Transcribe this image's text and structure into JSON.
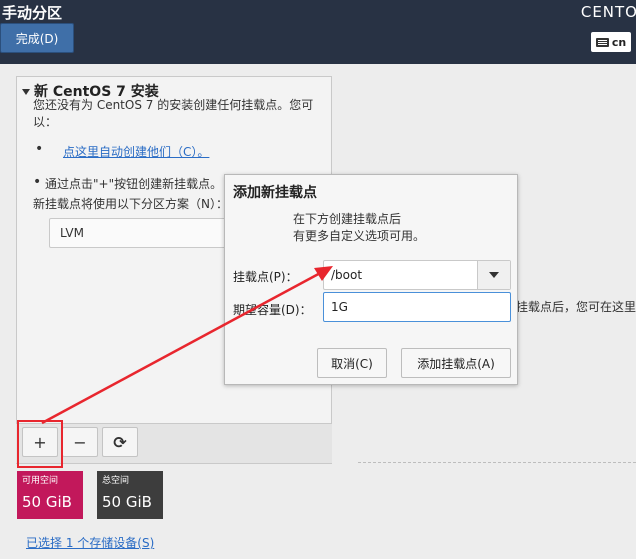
{
  "header": {
    "title": "手动分区",
    "product": "CENTO",
    "done_label": "完成(D)",
    "keyboard_layout": "cn"
  },
  "left_panel": {
    "section_title": "新 CentOS 7 安装",
    "description": "您还没有为 CentOS 7 的安装创建任何挂载点。您可以：",
    "auto_create_link": "点这里自动创建他们（C）。",
    "manual_hint": "通过点击\"+\"按钮创建新挂载点。",
    "scheme_label": "新挂载点将使用以下分区方案（N）：",
    "scheme_value": "LVM",
    "toolbar": {
      "add": "+",
      "remove": "−",
      "refresh": "⟳"
    }
  },
  "storage": {
    "available_label": "可用空间",
    "available_value": "50 GiB",
    "available_color": "#c2185b",
    "total_label": "总空间",
    "total_value": "50 GiB",
    "total_color": "#3d3d3d",
    "selected_link": "已选择 1 个存储设备(S)"
  },
  "right_panel": {
    "partial_text": "挂载点后，您可在这里"
  },
  "dialog": {
    "title": "添加新挂载点",
    "description_line1": "在下方创建挂载点后",
    "description_line2": "有更多自定义选项可用。",
    "mount_label": "挂载点(P)：",
    "mount_value": "/boot",
    "capacity_label": "期望容量(D)：",
    "capacity_value": "1G",
    "cancel_label": "取消(C)",
    "add_label": "添加挂载点(A)"
  },
  "colors": {
    "topbar": "#283244",
    "accent_blue": "#3f6fa8",
    "annotation_red": "#e8262e"
  }
}
